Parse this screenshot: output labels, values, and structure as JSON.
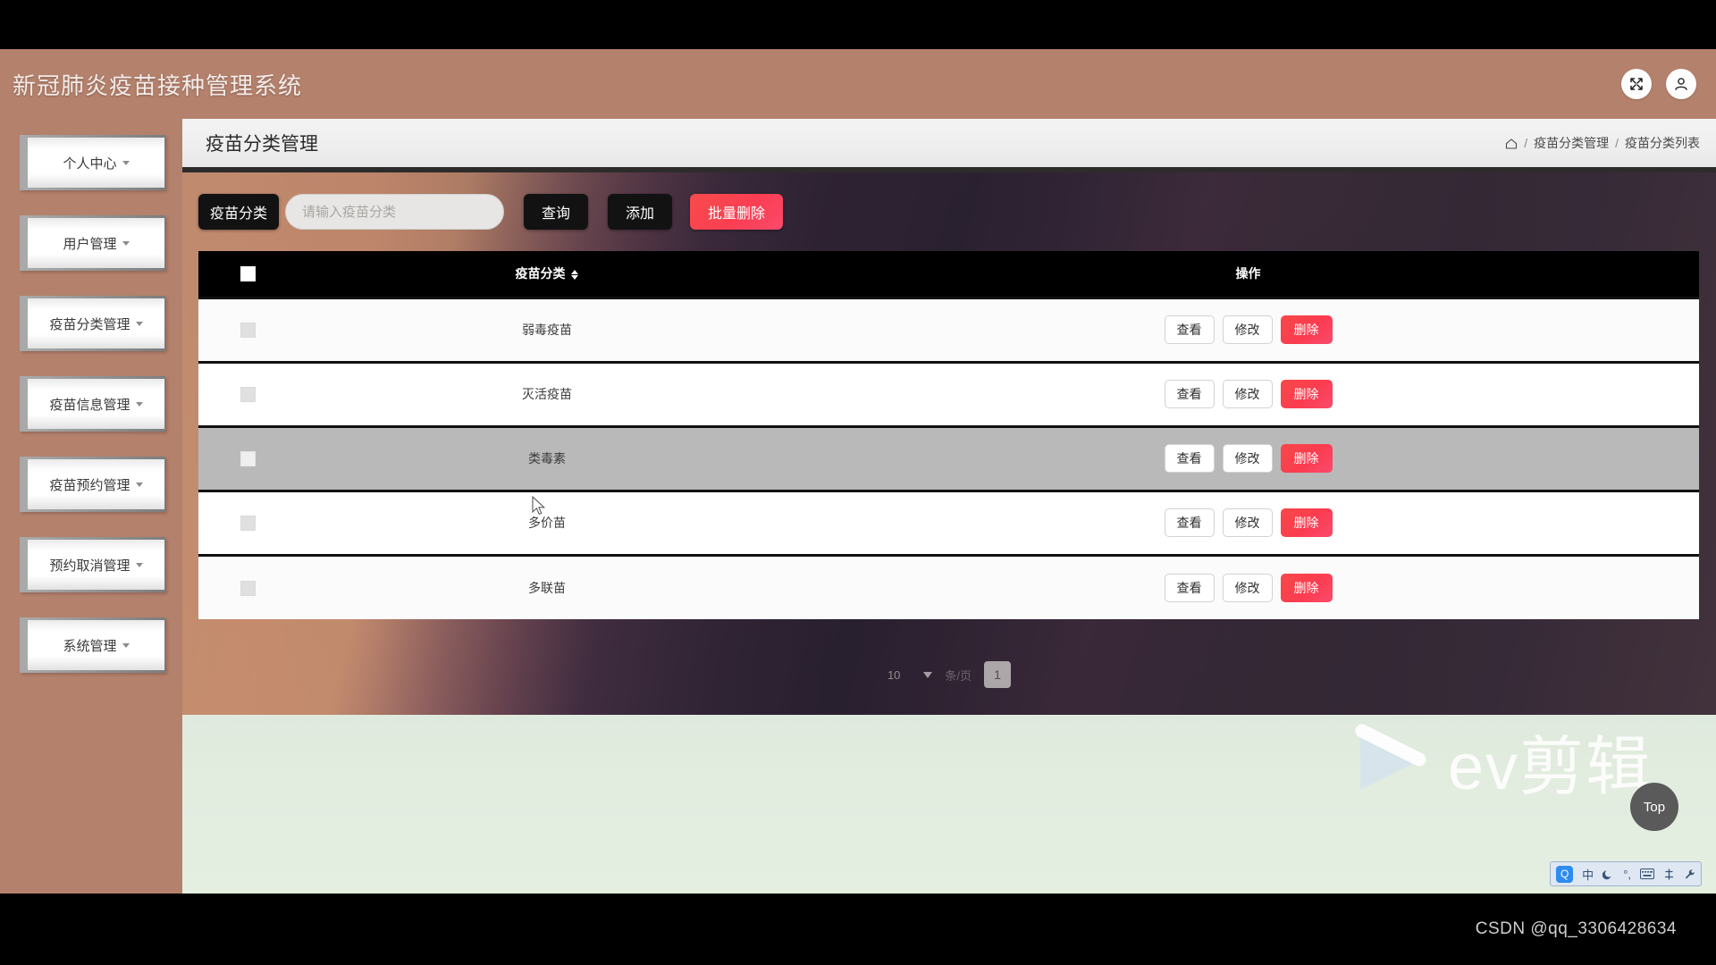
{
  "header": {
    "title": "新冠肺炎疫苗接种管理系统",
    "fullscreen_icon": "fullscreen-icon",
    "user_icon": "user-icon"
  },
  "sidebar": {
    "items": [
      {
        "label": "个人中心",
        "name": "sidebar-item-personal-center"
      },
      {
        "label": "用户管理",
        "name": "sidebar-item-user-management"
      },
      {
        "label": "疫苗分类管理",
        "name": "sidebar-item-vaccine-category-management"
      },
      {
        "label": "疫苗信息管理",
        "name": "sidebar-item-vaccine-info-management"
      },
      {
        "label": "疫苗预约管理",
        "name": "sidebar-item-vaccine-appointment-management"
      },
      {
        "label": "预约取消管理",
        "name": "sidebar-item-appointment-cancel-management"
      },
      {
        "label": "系统管理",
        "name": "sidebar-item-system-management"
      }
    ]
  },
  "page": {
    "title": "疫苗分类管理",
    "breadcrumb": {
      "home_icon": "home-icon",
      "items": [
        "疫苗分类管理",
        "疫苗分类列表"
      ],
      "separator": "/"
    }
  },
  "toolbar": {
    "field_label": "疫苗分类",
    "search_value": "",
    "search_placeholder": "请输入疫苗分类",
    "query_label": "查询",
    "add_label": "添加",
    "batch_delete_label": "批量删除",
    "danger_color": "#fb3e52",
    "button_color": "#121212"
  },
  "table": {
    "columns": [
      "",
      "疫苗分类",
      "操作"
    ],
    "sort_column": "疫苗分类",
    "rows": [
      {
        "name": "弱毒疫苗",
        "checked": false,
        "hovered": false
      },
      {
        "name": "灭活疫苗",
        "checked": false,
        "hovered": false
      },
      {
        "name": "类毒素",
        "checked": false,
        "hovered": true
      },
      {
        "name": "多价苗",
        "checked": false,
        "hovered": false
      },
      {
        "name": "多联苗",
        "checked": false,
        "hovered": false
      }
    ],
    "row_actions": {
      "view_label": "查看",
      "edit_label": "修改",
      "delete_label": "删除"
    }
  },
  "pagination": {
    "page_size": "10",
    "per_page_text": "条/页",
    "current_page": "1"
  },
  "overlays": {
    "watermark_text": "ev剪辑",
    "top_button_label": "Top",
    "csdn_credit": "CSDN @qq_3306428634",
    "ime": {
      "logo": "Q",
      "mode": "中",
      "moon_icon": "moon-icon",
      "punct_icon": "punctuation-icon",
      "keyboard_icon": "keyboard-icon",
      "tools_icon": "toolbox-icon",
      "wrench_icon": "wrench-icon"
    }
  }
}
